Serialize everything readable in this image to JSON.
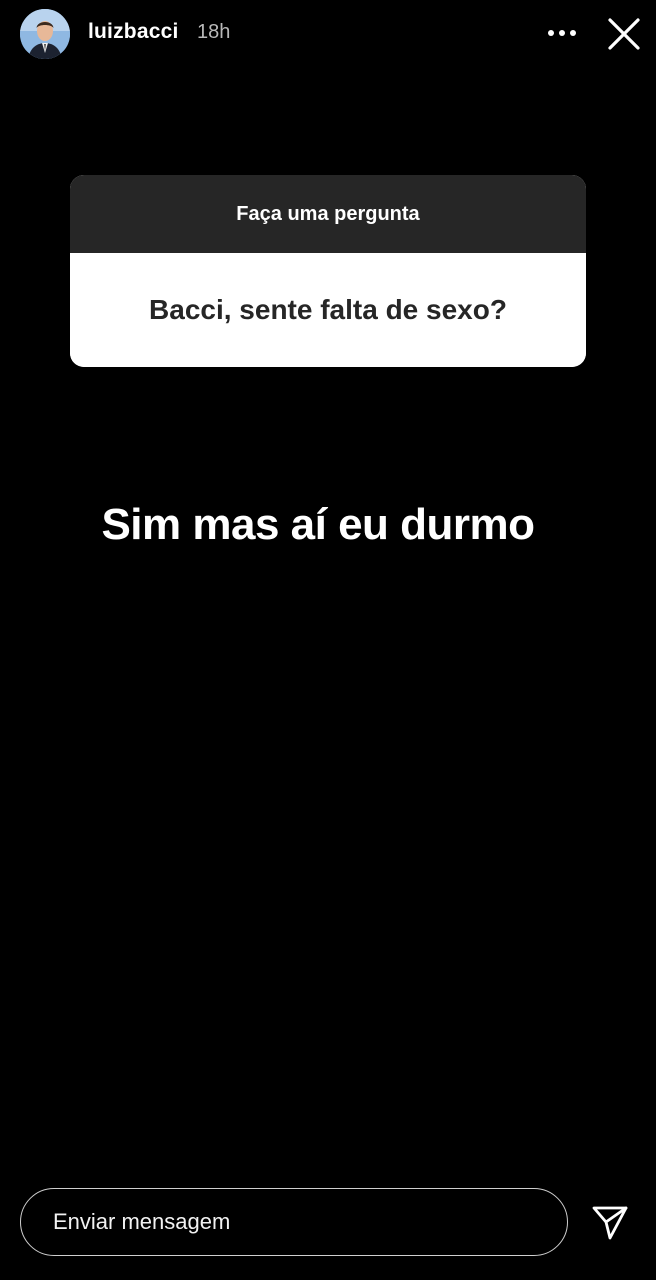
{
  "story_header": {
    "username": "luizbacci",
    "timestamp": "18h",
    "more_icon": "more-horizontal-icon",
    "close_icon": "close-icon"
  },
  "question_sticker": {
    "prompt": "Faça uma pergunta",
    "question": "Bacci, sente falta de sexo?",
    "header_color": "#262626",
    "body_color": "#ffffff"
  },
  "answer": {
    "text": "Sim mas aí eu durmo"
  },
  "reply_bar": {
    "placeholder": "Enviar mensagem",
    "send_icon": "send-icon"
  },
  "colors": {
    "background": "#000000",
    "text_primary": "#ffffff",
    "text_secondary": "#b8b8b8"
  }
}
